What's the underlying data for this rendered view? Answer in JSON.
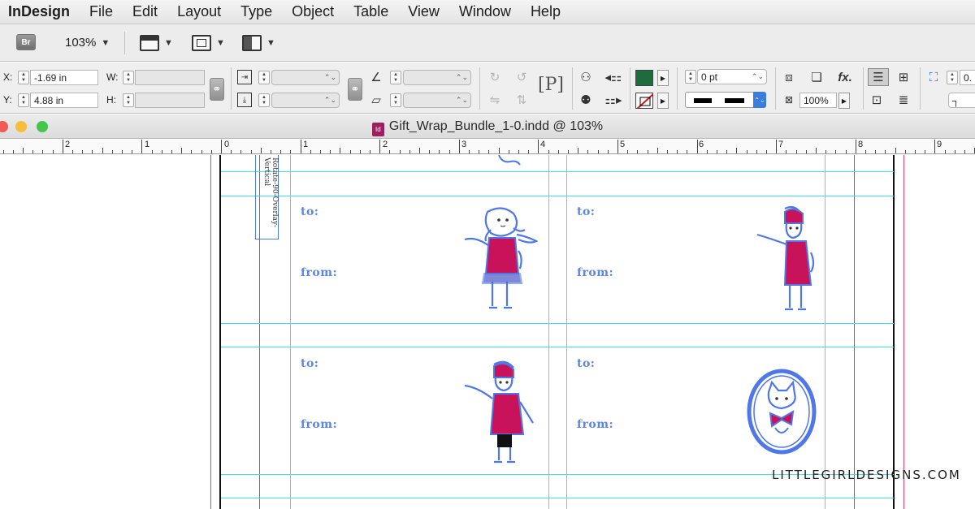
{
  "menubar": {
    "app_name": "InDesign",
    "items": [
      "File",
      "Edit",
      "Layout",
      "Type",
      "Object",
      "Table",
      "View",
      "Window",
      "Help"
    ]
  },
  "appbar": {
    "bridge_label": "Br",
    "zoom": "103%"
  },
  "control": {
    "x_label": "X:",
    "x_value": "-1.69 in",
    "y_label": "Y:",
    "y_value": "4.88 in",
    "w_label": "W:",
    "w_value": "",
    "h_label": "H:",
    "h_value": "",
    "stroke_weight": "0 pt",
    "opacity": "100%",
    "fx_label": "fx.",
    "p_glyph": "P",
    "last_field": "0.",
    "fill_color": "#1e6b3e"
  },
  "document": {
    "title": "Gift_Wrap_Bundle_1-0.indd @ 103%",
    "file_icon": "Id"
  },
  "ruler": {
    "labels": [
      "2",
      "1",
      "0",
      "1",
      "2",
      "3",
      "4",
      "5",
      "6",
      "7",
      "8",
      "9"
    ]
  },
  "page": {
    "slug_text": "Rotate-90-Overlay-Vertical",
    "tags": [
      {
        "to": "to:",
        "from": "from:"
      },
      {
        "to": "to:",
        "from": "from:"
      },
      {
        "to": "to:",
        "from": "from:"
      },
      {
        "to": "to:",
        "from": "from:"
      }
    ],
    "tag_colors": {
      "outline": "#4f77e8",
      "coat": "#c8125a"
    }
  },
  "watermark": "LITTLEGIRLDESIGNS.COM"
}
